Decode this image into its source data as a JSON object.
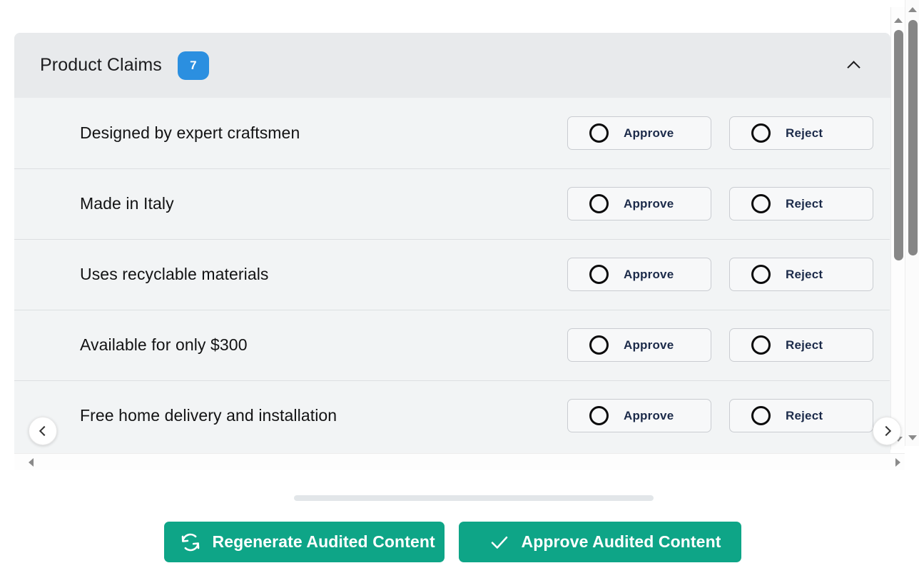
{
  "section": {
    "title": "Product Claims",
    "count": "7",
    "collapse_icon": "chevron-up-icon"
  },
  "claims": [
    {
      "text": "Designed by expert craftsmen",
      "approve_label": "Approve",
      "reject_label": "Reject"
    },
    {
      "text": "Made in Italy",
      "approve_label": "Approve",
      "reject_label": "Reject"
    },
    {
      "text": "Uses recyclable materials",
      "approve_label": "Approve",
      "reject_label": "Reject"
    },
    {
      "text": "Available for only $300",
      "approve_label": "Approve",
      "reject_label": "Reject"
    },
    {
      "text": "Free home delivery and installation",
      "approve_label": "Approve",
      "reject_label": "Reject"
    }
  ],
  "carousel": {
    "prev_icon": "chevron-left-icon",
    "next_icon": "chevron-right-icon"
  },
  "footer": {
    "regenerate_label": "Regenerate Audited Content",
    "regenerate_icon": "refresh-icon",
    "approve_label": "Approve Audited Content",
    "approve_icon": "check-icon"
  },
  "colors": {
    "accent_teal": "#0ea587",
    "badge_blue": "#2b8fe0",
    "header_bg": "#e8eaec",
    "card_bg": "#f2f4f5",
    "label_navy": "#1c2b4a"
  }
}
